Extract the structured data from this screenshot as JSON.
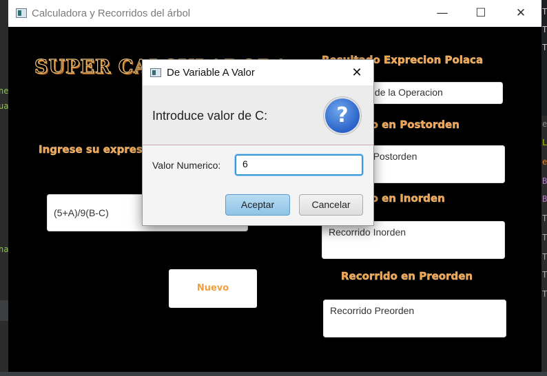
{
  "background": {
    "left_fragments": [
      "ne",
      "ua",
      "na"
    ],
    "right_fragments": [
      "T",
      "T",
      "T",
      "e",
      "L",
      "e",
      "B",
      "B",
      "T",
      "T",
      "T",
      "T",
      "T"
    ]
  },
  "window": {
    "title": "Calculadora y Recorridos del árbol",
    "minimize": "—",
    "maximize": "☐",
    "close": "✕"
  },
  "main": {
    "heading": "SUPER CALCULADORA",
    "expression_label": "Ingrese su expresion",
    "expression_value": "(5+A)/9(B-C)",
    "nuevo_button": "Nuevo",
    "result_label": "Resultado Exprecion Polaca",
    "result_value": "Resultado de la Operacion",
    "postorden_label": "Recorrido en Postorden",
    "postorden_value": "Recorrido Postorden",
    "inorden_label": "Recorrido en Inorden",
    "inorden_value": "Recorrido Inorden",
    "preorden_label": "Recorrido en Preorden",
    "preorden_value": "Recorrido Preorden"
  },
  "dialog": {
    "title": "De Variable A Valor",
    "close": "✕",
    "prompt": "Introduce valor de C:",
    "question_mark": "?",
    "value_label": "Valor Numerico:",
    "value_input": "6",
    "ok_button": "Aceptar",
    "cancel_button": "Cancelar"
  },
  "colors": {
    "accent_orange": "#f0a04a",
    "dialog_focus": "#3a9ad9",
    "window_bg": "#000000"
  }
}
